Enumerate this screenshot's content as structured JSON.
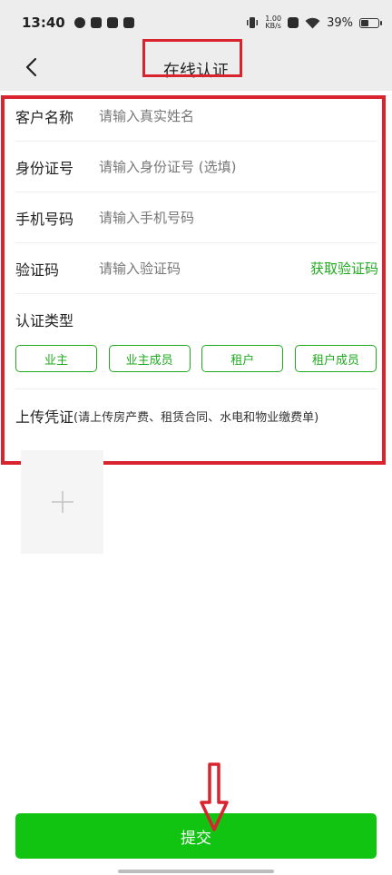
{
  "status_bar": {
    "time": "13:40",
    "net_speed_value": "1.00",
    "net_speed_unit": "KB/s",
    "battery_text": "39%",
    "battery_level": 0.39
  },
  "header": {
    "title": "在线认证"
  },
  "form": {
    "name": {
      "label": "客户名称",
      "placeholder": "请输入真实姓名"
    },
    "id_card": {
      "label": "身份证号",
      "placeholder": "请输入身份证号 (选填)"
    },
    "phone": {
      "label": "手机号码",
      "placeholder": "请输入手机号码"
    },
    "code": {
      "label": "验证码",
      "placeholder": "请输入验证码",
      "button": "获取验证码"
    },
    "auth_type": {
      "label": "认证类型",
      "options": [
        "业主",
        "业主成员",
        "租户",
        "租户成员"
      ]
    },
    "upload": {
      "label": "上传凭证",
      "hint": "(请上传房产费、租赁合同、水电和物业缴费单)"
    }
  },
  "submit_label": "提交",
  "colors": {
    "accent_green": "#1eaa1e",
    "submit_green": "#12c412",
    "annotation_red": "#d9232e"
  }
}
